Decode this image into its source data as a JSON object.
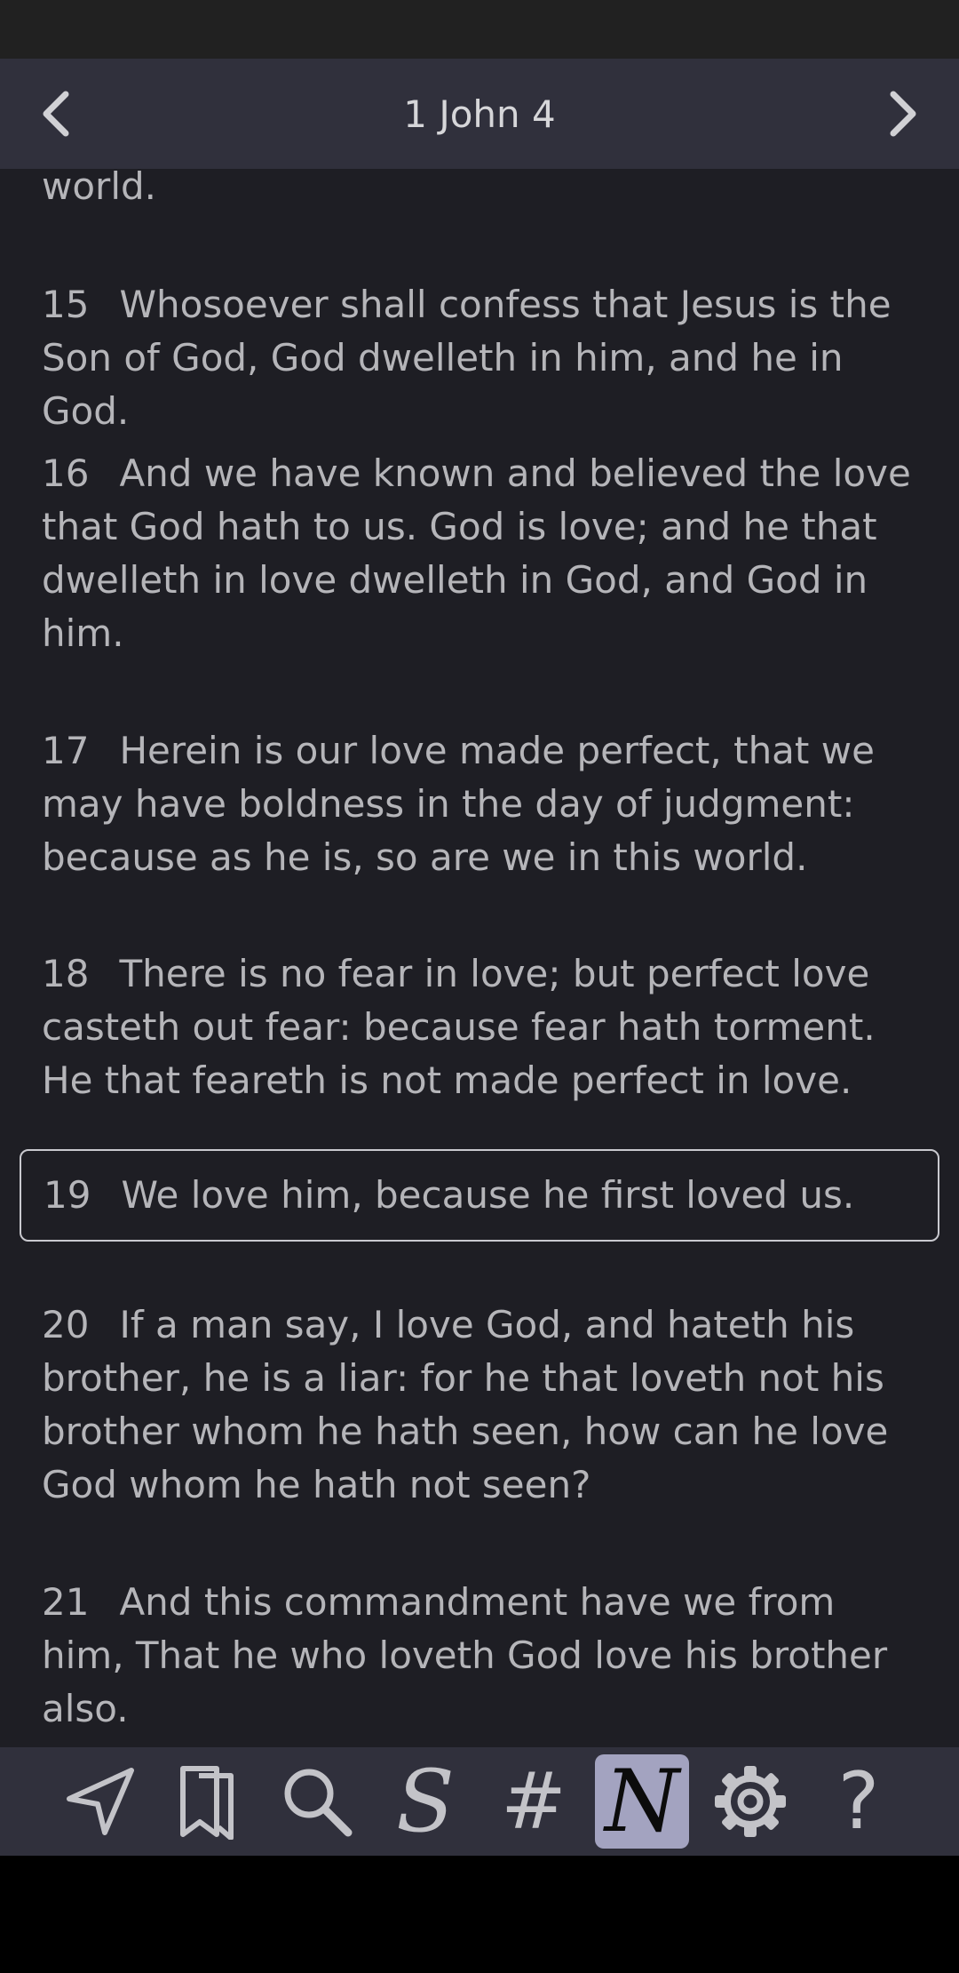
{
  "header": {
    "title": "1 John 4"
  },
  "verses": [
    {
      "num": "",
      "text": "world."
    },
    {
      "num": "15",
      "text": "Whosoever shall confess that Jesus is the Son of God, God dwelleth in him, and he in God."
    },
    {
      "num": "16",
      "text": "And we have known and believed the love that God hath to us. God is love; and he that dwelleth in love dwelleth in God, and God in him."
    },
    {
      "num": "17",
      "text": "Herein is our love made perfect, that we may have boldness in the day of judgment: because as he is, so are we in this world."
    },
    {
      "num": "18",
      "text": "There is no fear in love; but perfect love casteth out fear: because fear hath torment. He that feareth is not made perfect in love."
    },
    {
      "num": "19",
      "text": "We love him, because he first loved us."
    },
    {
      "num": "20",
      "text": "If a man say, I love God, and hateth his brother, he is a liar: for he that loveth not his brother whom he hath seen, how can he love God whom he hath not seen?"
    },
    {
      "num": "21",
      "text": "And this commandment have we from him, That he who loveth God love his brother also."
    }
  ],
  "toolbar": {
    "strongs_label": "S",
    "number_label": "#",
    "notes_label": "N",
    "help_label": "?"
  },
  "icons": {
    "prev": "chevron-left-icon",
    "next": "chevron-right-icon",
    "goto": "navigation-arrow-icon",
    "bookmarks": "bookmark-icon",
    "search": "search-icon",
    "settings": "gear-icon"
  },
  "colors": {
    "header_bg": "#30303c",
    "content_bg": "#1e1e24",
    "text": "#b5b5b9",
    "active_tool_bg": "#a3a3c0"
  }
}
